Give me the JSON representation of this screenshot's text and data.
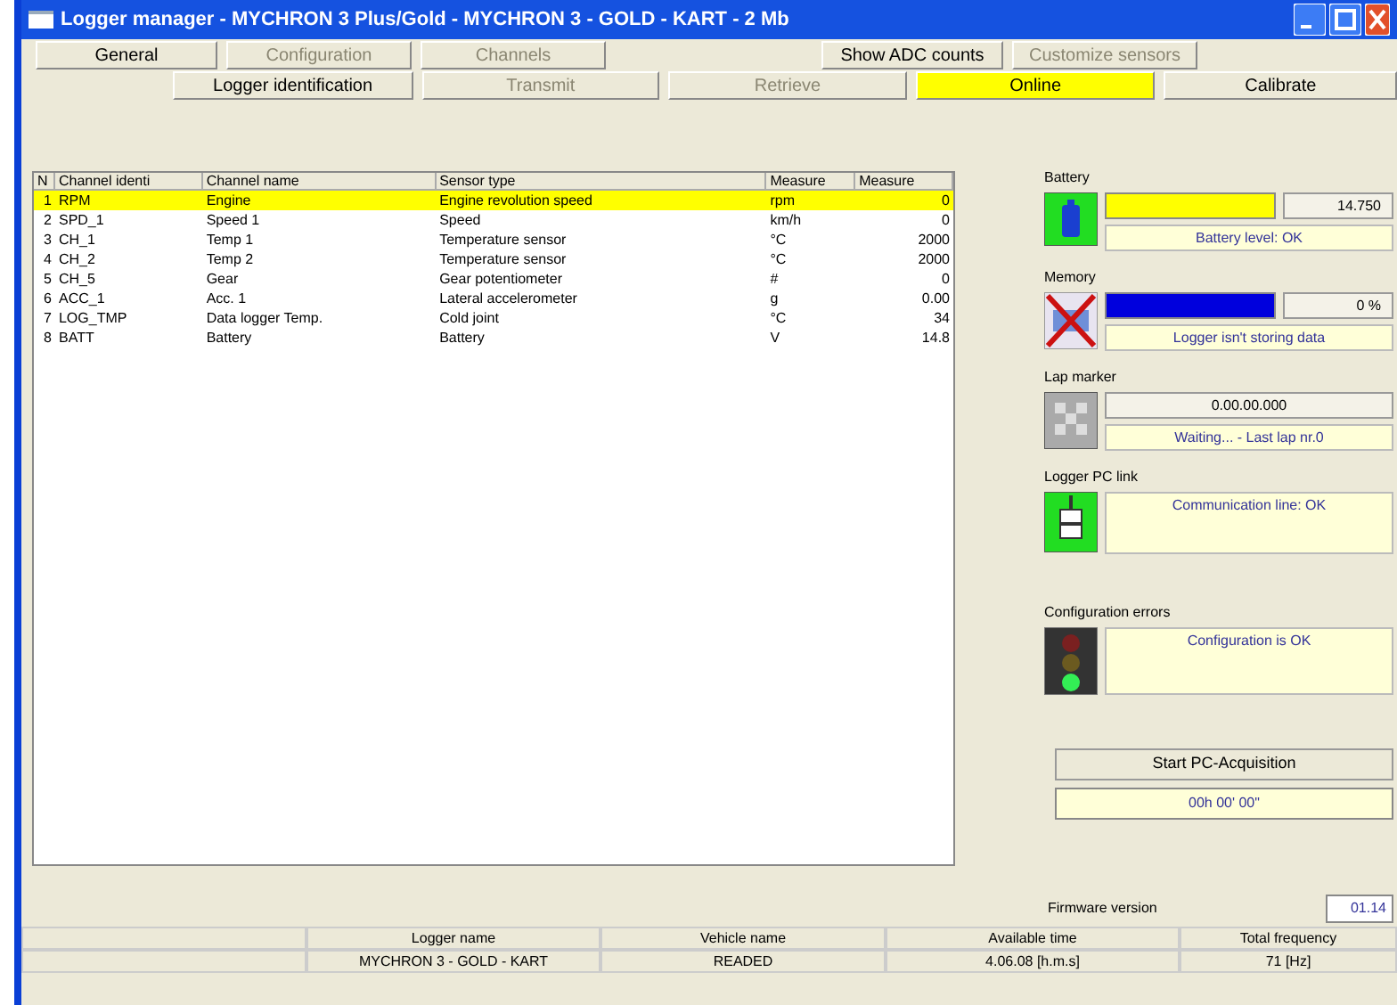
{
  "window": {
    "title": "Logger manager - MYCHRON 3 Plus/Gold - MYCHRON 3 - GOLD - KART - 2 Mb"
  },
  "toolbar_rows": [
    [
      {
        "label": "General",
        "disabled": false,
        "selected": false
      },
      {
        "label": "Configuration",
        "disabled": true,
        "selected": false
      },
      {
        "label": "Channels",
        "disabled": true,
        "selected": false
      },
      {
        "kind": "gap"
      },
      {
        "label": "Show ADC counts",
        "disabled": false,
        "selected": false
      },
      {
        "label": "Customize sensors",
        "disabled": true,
        "selected": false
      }
    ],
    [
      {
        "label": "Logger identification",
        "disabled": false,
        "selected": false
      },
      {
        "label": "Transmit",
        "disabled": true,
        "selected": false
      },
      {
        "label": "Retrieve",
        "disabled": true,
        "selected": false
      },
      {
        "label": "Online",
        "disabled": false,
        "selected": true
      },
      {
        "label": "Calibrate",
        "disabled": false,
        "selected": false
      }
    ]
  ],
  "table": {
    "columns": [
      "N",
      "Channel identi",
      "Channel name",
      "Sensor type",
      "Measure",
      "Measure"
    ],
    "rows": [
      {
        "cells": [
          "1",
          "RPM",
          "Engine",
          "Engine revolution speed",
          "rpm",
          "0"
        ],
        "selected": true
      },
      {
        "cells": [
          "2",
          "SPD_1",
          "Speed 1",
          "Speed",
          "km/h",
          "0"
        ],
        "selected": false
      },
      {
        "cells": [
          "3",
          "CH_1",
          "Temp 1",
          "Temperature sensor",
          "°C",
          "2000"
        ],
        "selected": false
      },
      {
        "cells": [
          "4",
          "CH_2",
          "Temp 2",
          "Temperature sensor",
          "°C",
          "2000"
        ],
        "selected": false
      },
      {
        "cells": [
          "5",
          "CH_5",
          "Gear",
          "Gear potentiometer",
          "#",
          "0"
        ],
        "selected": false
      },
      {
        "cells": [
          "6",
          "ACC_1",
          "Acc. 1",
          "Lateral accelerometer",
          "g",
          "0.00"
        ],
        "selected": false
      },
      {
        "cells": [
          "7",
          "LOG_TMP",
          "Data logger Temp.",
          "Cold joint",
          "°C",
          "34"
        ],
        "selected": false
      },
      {
        "cells": [
          "8",
          "BATT",
          "Battery",
          "Battery",
          "V",
          "14.8"
        ],
        "selected": false
      }
    ]
  },
  "status_panel": [
    {
      "kind": "battery",
      "label": "Battery",
      "level": 1,
      "reading": "14.750",
      "message": "Battery level: OK"
    },
    {
      "kind": "memory",
      "label": "Memory",
      "level": 1,
      "reading": "0 %",
      "message": "Logger isn't storing data"
    },
    {
      "kind": "lap",
      "label": "Lap marker",
      "reading": "0.00.00.000",
      "message": "Waiting... - Last lap nr.0"
    },
    {
      "kind": "link",
      "label": "Logger PC link",
      "message": "Communication line: OK"
    },
    {
      "kind": "config",
      "label": "Configuration errors",
      "message": "Configuration is OK"
    }
  ],
  "acquisition": {
    "button": "Start PC-Acquisition",
    "time": "00h 00' 00\""
  },
  "firmware": {
    "label": "Firmware version",
    "value": "01.14"
  },
  "status_bar": {
    "columns": [
      "Logger name",
      "Vehicle name",
      "Available time",
      "Total frequency"
    ],
    "values": [
      "MYCHRON 3 - GOLD - KART",
      "READED",
      "4.06.08 [h.m.s]",
      "71 [Hz]"
    ]
  }
}
